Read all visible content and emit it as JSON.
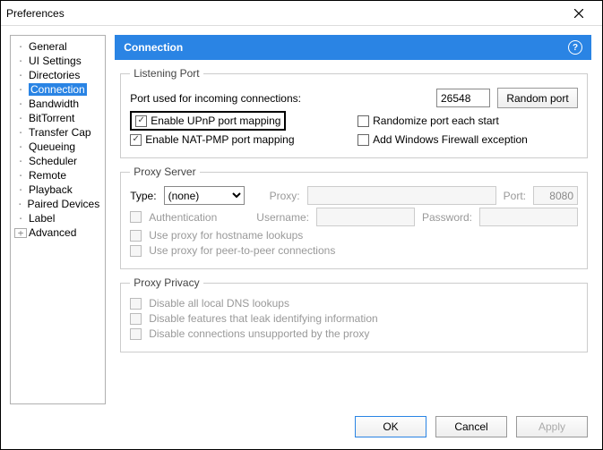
{
  "window": {
    "title": "Preferences"
  },
  "tree": {
    "items": [
      "General",
      "UI Settings",
      "Directories",
      "Connection",
      "Bandwidth",
      "BitTorrent",
      "Transfer Cap",
      "Queueing",
      "Scheduler",
      "Remote",
      "Playback",
      "Paired Devices",
      "Label",
      "Advanced"
    ],
    "selected_index": 3,
    "expand_index": 13
  },
  "header": {
    "title": "Connection"
  },
  "listening": {
    "legend": "Listening Port",
    "port_label": "Port used for incoming connections:",
    "port_value": "26548",
    "random_btn": "Random port",
    "upnp": "Enable UPnP port mapping",
    "natpmp": "Enable NAT-PMP port mapping",
    "randomize": "Randomize port each start",
    "firewall": "Add Windows Firewall exception"
  },
  "proxy": {
    "legend": "Proxy Server",
    "type_label": "Type:",
    "type_value": "(none)",
    "proxy_label": "Proxy:",
    "port_label": "Port:",
    "port_value": "8080",
    "auth": "Authentication",
    "user_label": "Username:",
    "pass_label": "Password:",
    "hostname": "Use proxy for hostname lookups",
    "p2p": "Use proxy for peer-to-peer connections"
  },
  "privacy": {
    "legend": "Proxy Privacy",
    "dns": "Disable all local DNS lookups",
    "leak": "Disable features that leak identifying information",
    "unsupported": "Disable connections unsupported by the proxy"
  },
  "footer": {
    "ok": "OK",
    "cancel": "Cancel",
    "apply": "Apply"
  }
}
